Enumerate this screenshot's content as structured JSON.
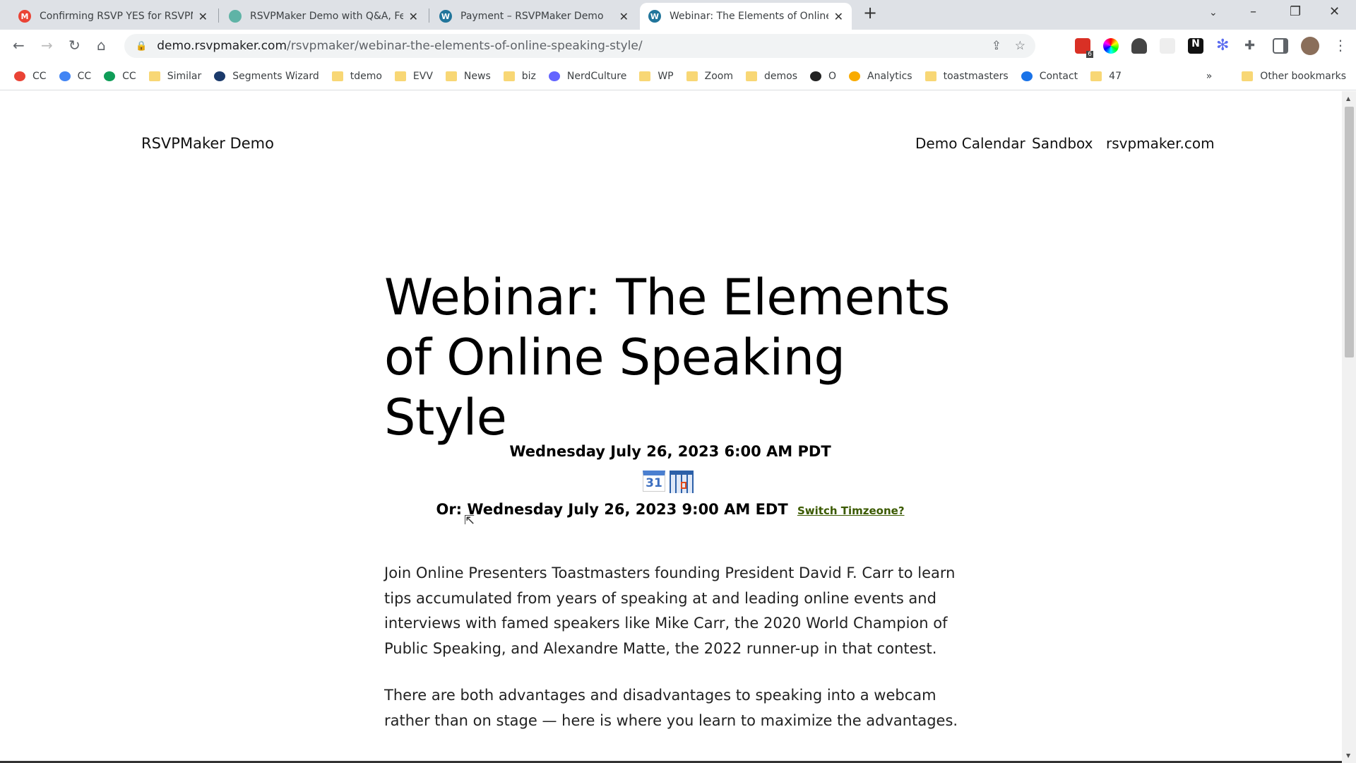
{
  "browser": {
    "tabs": [
      {
        "title": "Confirming RSVP YES for RSVPMaker",
        "icon": "gmail-icon",
        "color": "#ea4335"
      },
      {
        "title": "RSVPMaker Demo with Q&A, Feat",
        "icon": "site-icon",
        "color": "#5fb3a6"
      },
      {
        "title": "Payment – RSVPMaker Demo",
        "icon": "wordpress-icon",
        "color": "#21759b"
      },
      {
        "title": "Webinar: The Elements of Online",
        "icon": "wordpress-icon",
        "color": "#21759b"
      }
    ],
    "new_tab": "+",
    "url_host": "demo.rsvpmaker.com",
    "url_path": "/rsvpmaker/webinar-the-elements-of-online-speaking-style/",
    "extension_badge": "6",
    "bookmarks": [
      {
        "label": "CC",
        "icon": "gmail-icon",
        "color": "#ea4335"
      },
      {
        "label": "CC",
        "icon": "google-icon",
        "color": "#4285f4"
      },
      {
        "label": "CC",
        "icon": "drive-icon",
        "color": "#0f9d58"
      },
      {
        "label": "Similar",
        "icon": "folder-icon"
      },
      {
        "label": "Segments Wizard",
        "icon": "segments-icon",
        "color": "#1b3a6b"
      },
      {
        "label": "tdemo",
        "icon": "folder-icon"
      },
      {
        "label": "EVV",
        "icon": "folder-icon"
      },
      {
        "label": "News",
        "icon": "folder-icon"
      },
      {
        "label": "biz",
        "icon": "folder-icon"
      },
      {
        "label": "NerdCulture",
        "icon": "mastodon-icon",
        "color": "#6364ff"
      },
      {
        "label": "WP",
        "icon": "folder-icon"
      },
      {
        "label": "Zoom",
        "icon": "folder-icon"
      },
      {
        "label": "demos",
        "icon": "folder-icon"
      },
      {
        "label": "O",
        "icon": "circle-icon",
        "color": "#222"
      },
      {
        "label": "Analytics",
        "icon": "analytics-icon",
        "color": "#f9ab00"
      },
      {
        "label": "toastmasters",
        "icon": "folder-icon"
      },
      {
        "label": "Contact",
        "icon": "person-icon",
        "color": "#1a73e8"
      },
      {
        "label": "47",
        "icon": "folder-icon"
      }
    ],
    "more": "»",
    "other_bookmarks": "Other bookmarks"
  },
  "site": {
    "title": "RSVPMaker Demo",
    "nav": [
      "Demo Calendar",
      "Sandbox",
      "rsvpmaker.com"
    ]
  },
  "post": {
    "title": "Webinar: The Elements of Online Speaking Style",
    "date": "Wednesday July 26, 2023 6:00 AM PDT",
    "calendar_day": "31",
    "alt_date": "Or: Wednesday July 26, 2023 9:00 AM EDT",
    "switch_timezone": "Switch Timzeone?",
    "paragraphs": [
      "Join Online Presenters Toastmasters founding President David F. Carr to learn tips accumulated from years of speaking at and leading online events and interviews with famed speakers like Mike Carr, the 2020 World Champion of Public Speaking, and Alexandre Matte, the 2022 runner-up in that contest.",
      "There are both advantages and disadvantages to speaking into a webcam rather than on stage — here is where you learn to maximize the advantages."
    ]
  }
}
